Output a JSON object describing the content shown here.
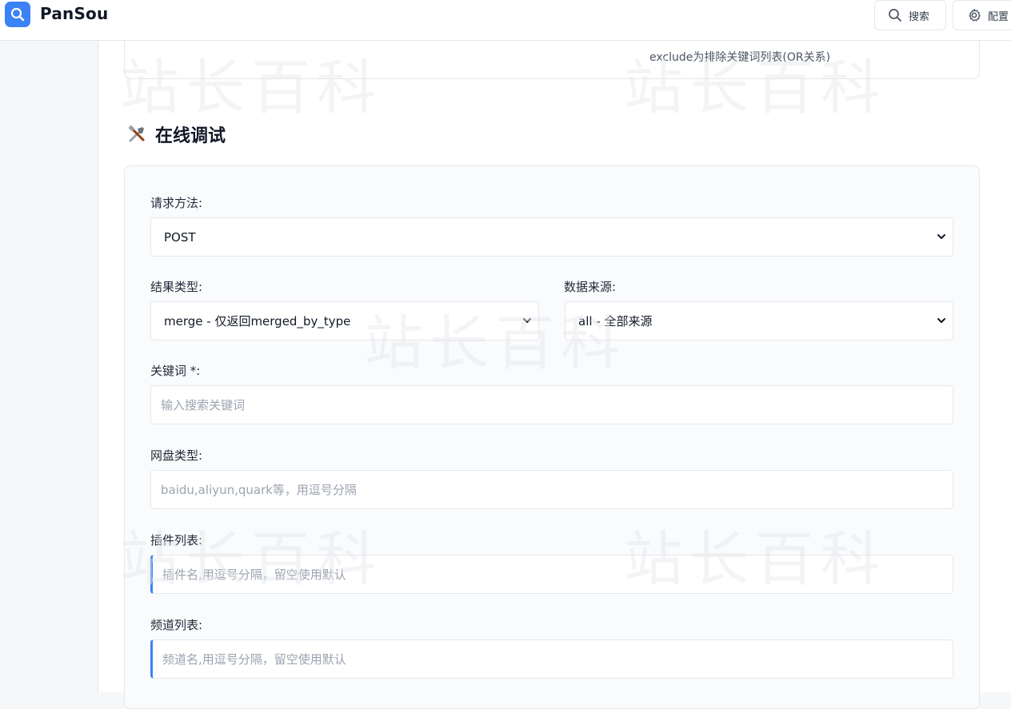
{
  "header": {
    "brand": "PanSou",
    "search_label": "搜索",
    "config_label": "配置"
  },
  "params_table": {
    "desc_line2": "exclude为排除关键词列表(OR关系)"
  },
  "debug": {
    "title": "在线调试",
    "method": {
      "label": "请求方法:",
      "value": "POST"
    },
    "result_type": {
      "label": "结果类型:",
      "value": "merge - 仅返回merged_by_type"
    },
    "source": {
      "label": "数据来源:",
      "value": "all - 全部来源"
    },
    "keyword": {
      "label": "关键词 *:",
      "placeholder": "输入搜索关键词"
    },
    "cloud_types": {
      "label": "网盘类型:",
      "placeholder": "baidu,aliyun,quark等，用逗号分隔"
    },
    "plugins": {
      "label": "插件列表:",
      "placeholder": "插件名,用逗号分隔，留空使用默认"
    },
    "channels": {
      "label": "频道列表:",
      "placeholder": "频道名,用逗号分隔，留空使用默认"
    }
  },
  "watermark": "站长百科",
  "colors": {
    "accent": "#3b82f6",
    "border": "#e5e7eb",
    "placeholder": "#9ca3af"
  },
  "icons": {
    "logo": "search-icon",
    "search": "search-icon",
    "config": "gear-icon",
    "section": "tools-icon",
    "select": "chevron-down-icon"
  }
}
